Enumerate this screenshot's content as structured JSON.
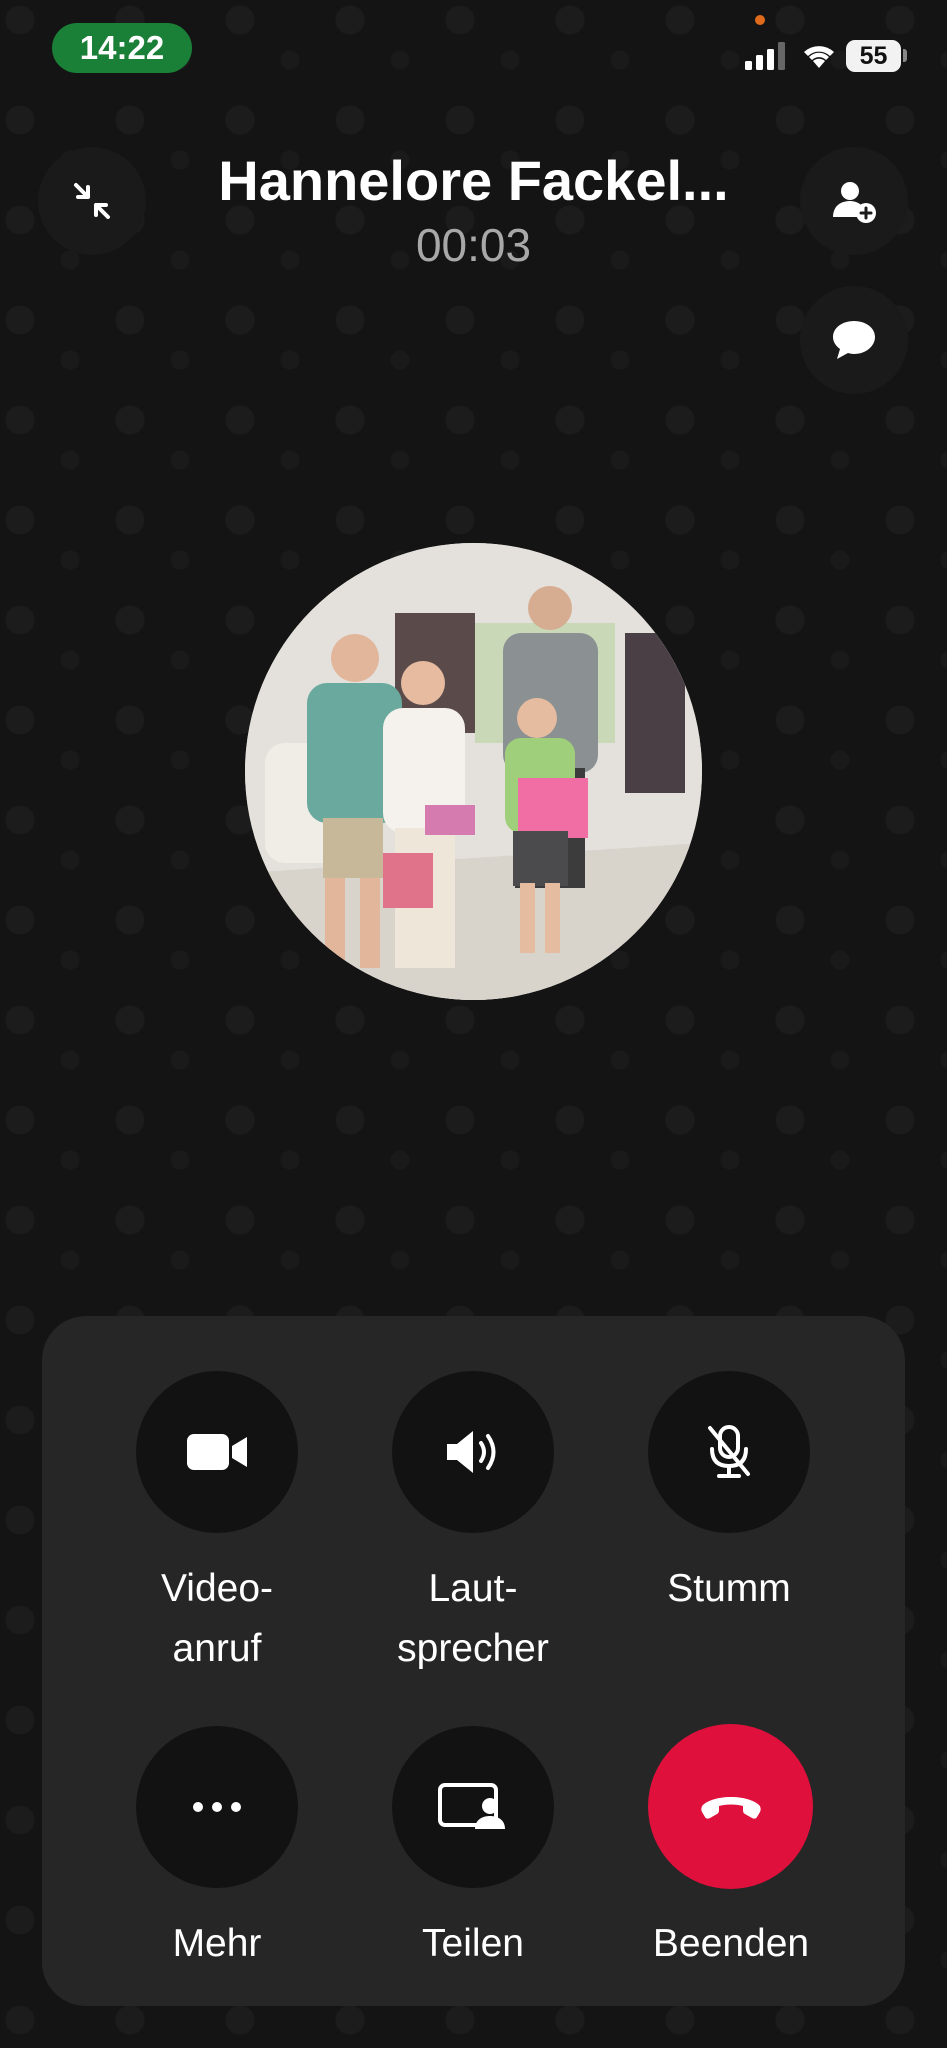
{
  "status_bar": {
    "time": "14:22",
    "battery": "55"
  },
  "call": {
    "name": "Hannelore Fackel...",
    "duration": "00:03"
  },
  "controls": {
    "video": {
      "line1": "Video-",
      "line2": "anruf"
    },
    "speaker": {
      "line1": "Laut-",
      "line2": "sprecher"
    },
    "mute": {
      "label": "Stumm"
    },
    "more": {
      "label": "Mehr"
    },
    "share": {
      "label": "Teilen"
    },
    "end": {
      "label": "Beenden"
    }
  },
  "colors": {
    "time_pill": "#1a7f37",
    "end_button": "#e0103d",
    "panel": "#262626"
  }
}
